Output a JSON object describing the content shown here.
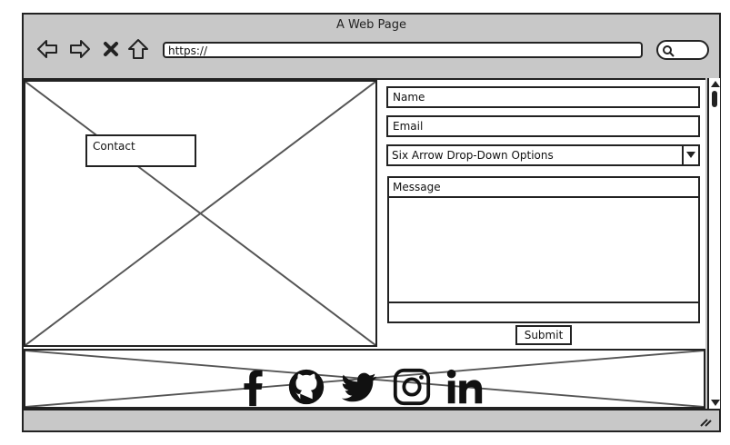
{
  "window": {
    "title": "A Web Page"
  },
  "nav": {
    "back_icon": "back-arrow-icon",
    "forward_icon": "forward-arrow-icon",
    "stop_icon": "close-icon",
    "home_icon": "home-icon",
    "search_icon": "search-icon"
  },
  "address_bar": {
    "value": "https://"
  },
  "hero": {
    "contact_label": "Contact"
  },
  "form": {
    "name_placeholder": "Name",
    "email_placeholder": "Email",
    "dropdown_selected": "Six Arrow Drop-Down Options",
    "message_label": "Message",
    "submit_label": "Submit"
  },
  "social": [
    "facebook-icon",
    "github-icon",
    "twitter-icon",
    "instagram-icon",
    "linkedin-icon"
  ]
}
